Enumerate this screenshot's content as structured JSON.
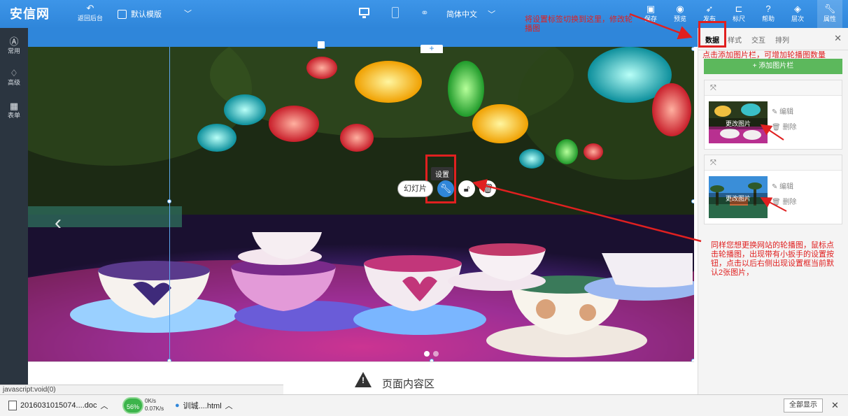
{
  "topbar": {
    "logo": "安信网",
    "back_label": "返回后台",
    "template_label": "默认模版",
    "language": "简体中文",
    "buttons": [
      {
        "label": "保存",
        "icon": "save-icon"
      },
      {
        "label": "预览",
        "icon": "eye-icon"
      },
      {
        "label": "发布",
        "icon": "send-icon"
      },
      {
        "label": "标尺",
        "icon": "ruler-icon"
      },
      {
        "label": "帮助",
        "icon": "help-icon"
      },
      {
        "label": "层次",
        "icon": "layers-icon"
      },
      {
        "label": "属性",
        "icon": "wrench-icon"
      }
    ]
  },
  "sidebar": {
    "items": [
      {
        "label": "常用",
        "icon": "circle-a-icon"
      },
      {
        "label": "高级",
        "icon": "diamond-icon"
      },
      {
        "label": "表单",
        "icon": "form-icon"
      }
    ]
  },
  "canvas": {
    "slide_label": "幻灯片",
    "setting_tip": "设置",
    "content_title": "页面内容区",
    "slide_count": 2,
    "active_slide": 1
  },
  "panel": {
    "tabs": [
      "数据",
      "样式",
      "交互",
      "排列"
    ],
    "active_tab": "数据",
    "add_button": "+ 添加图片栏",
    "cards": [
      {
        "thumb_label": "更改图片",
        "edit": "编辑",
        "delete": "删除"
      },
      {
        "thumb_label": "更改图片",
        "edit": "编辑",
        "delete": "删除"
      }
    ]
  },
  "annotations": {
    "top_note": "将设置标签切换到这里，修改轮播图",
    "panel_note": "点击添加图片栏，可增加轮播图数量",
    "right_note": "同样您想更换网站的轮播图，鼠标点击轮播图，出现带有小扳手的设置按钮，点击以后右侧出现设置框当前默认2张图片，"
  },
  "status_url": "javascript:void(0)",
  "taskbar": {
    "download_1": "2016031015074....doc",
    "percent": "56%",
    "speed_up": "0K/s",
    "speed_down": "0.07K/s",
    "download_2": "训城....html",
    "show_all": "全部显示"
  },
  "colors": {
    "topbar": "#2f86da",
    "sidebar": "#2b3540",
    "add_button": "#5cb85c",
    "annotation": "#e02020"
  }
}
